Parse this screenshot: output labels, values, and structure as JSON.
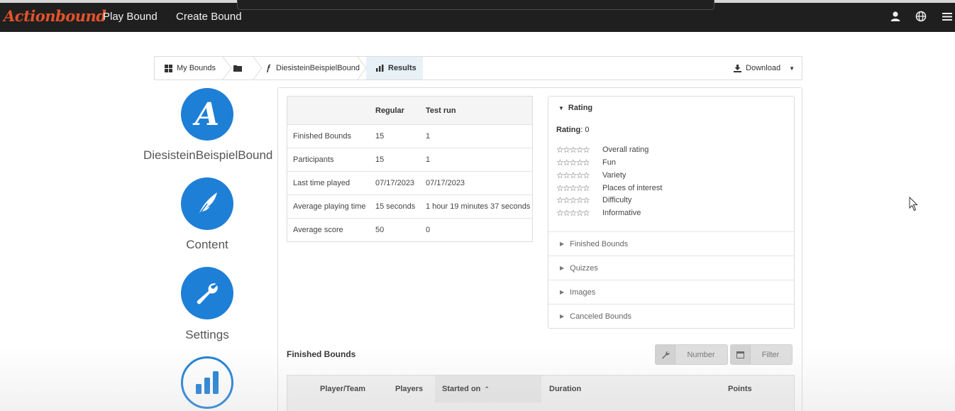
{
  "topnav": {
    "logo": "Actionbound",
    "links": [
      "Play Bound",
      "Create Bound"
    ],
    "icons": [
      "user-icon",
      "globe-icon",
      "menu-icon"
    ]
  },
  "breadcrumb": {
    "items": [
      {
        "label": "My Bounds",
        "icon": "grid-icon"
      },
      {
        "label": "",
        "icon": "folder-icon"
      },
      {
        "label": "DiesisteinBeispielBound",
        "icon": "bound-icon"
      },
      {
        "label": "Results",
        "icon": "bar-chart-icon",
        "active": true
      }
    ],
    "download": "Download"
  },
  "sidebar": {
    "bound_name": "DiesisteinBeispielBound",
    "items": [
      {
        "label": "Content",
        "icon": "quill-icon"
      },
      {
        "label": "Settings",
        "icon": "wrench-icon"
      },
      {
        "label": "",
        "icon": "bar-chart-icon"
      }
    ]
  },
  "stats": {
    "headers": [
      "",
      "Regular",
      "Test run"
    ],
    "rows": [
      [
        "Finished Bounds",
        "15",
        "1"
      ],
      [
        "Participants",
        "15",
        "1"
      ],
      [
        "Last time played",
        "07/17/2023",
        "07/17/2023"
      ],
      [
        "Average playing time",
        "15 seconds",
        "1 hour 19 minutes 37 seconds"
      ],
      [
        "Average score",
        "50",
        "0"
      ]
    ]
  },
  "rating": {
    "title": "Rating",
    "label": "Rating",
    "value": ": 0",
    "stars": "☆☆☆☆☆",
    "categories": [
      "Overall rating",
      "Fun",
      "Variety",
      "Places of interest",
      "Difficulty",
      "Informative"
    ],
    "sections": [
      "Finished Bounds",
      "Quizzes",
      "Images",
      "Canceled Bounds"
    ]
  },
  "finished": {
    "title": "Finished Bounds",
    "number_button": "Number",
    "filter_button": "Filter",
    "columns": [
      "Player/Team",
      "Players",
      "Started on",
      "Duration",
      "Points"
    ]
  },
  "colors": {
    "brand": "#e3532b",
    "accent_blue": "#1e7fd6",
    "topbar": "#1f1f1f"
  }
}
